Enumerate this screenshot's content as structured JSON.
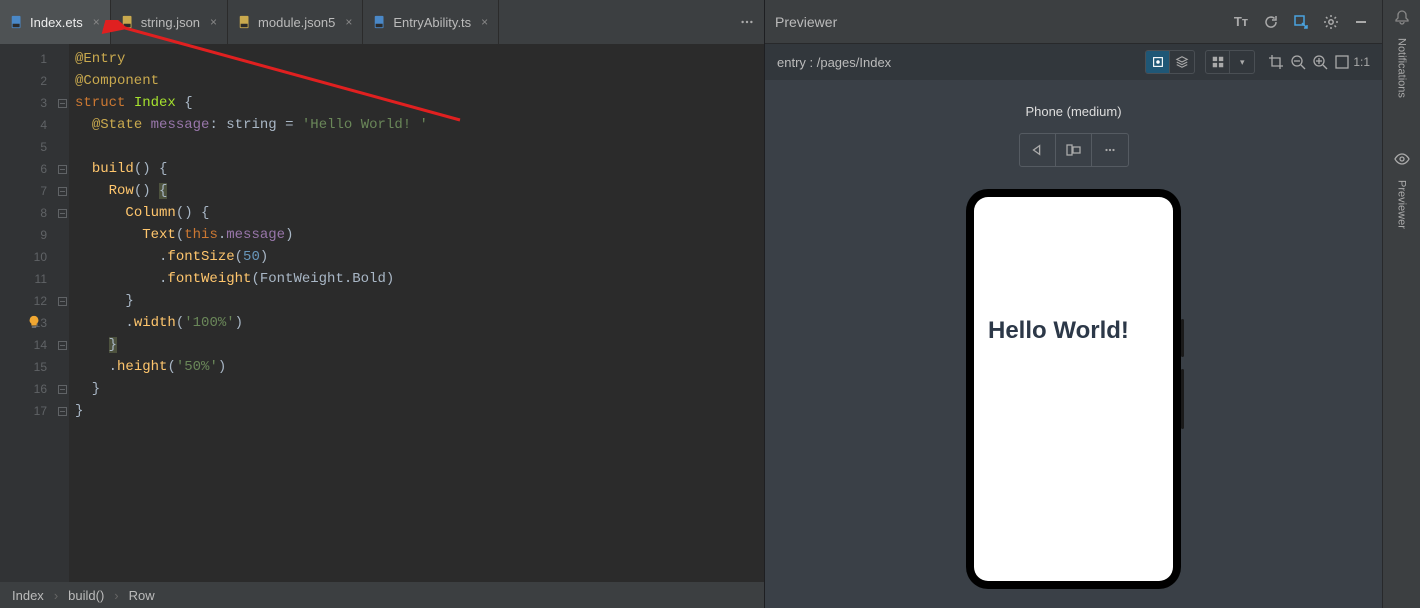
{
  "tabs": [
    {
      "label": "Index.ets",
      "active": true,
      "type": "ets"
    },
    {
      "label": "string.json",
      "active": false,
      "type": "json"
    },
    {
      "label": "module.json5",
      "active": false,
      "type": "json5"
    },
    {
      "label": "EntryAbility.ts",
      "active": false,
      "type": "ts"
    }
  ],
  "line_count": 17,
  "code_lines": [
    [
      {
        "c": "tok-ann",
        "t": "@Entry"
      }
    ],
    [
      {
        "c": "tok-ann",
        "t": "@Component"
      }
    ],
    [
      {
        "c": "tok-kw",
        "t": "struct"
      },
      {
        "c": "",
        "t": " "
      },
      {
        "c": "tok-struct",
        "t": "Index"
      },
      {
        "c": "",
        "t": " {"
      }
    ],
    [
      {
        "c": "",
        "t": "  "
      },
      {
        "c": "tok-ann",
        "t": "@State"
      },
      {
        "c": "",
        "t": " "
      },
      {
        "c": "tok-prop",
        "t": "message"
      },
      {
        "c": "",
        "t": ": "
      },
      {
        "c": "tok-type",
        "t": "string"
      },
      {
        "c": "",
        "t": " = "
      },
      {
        "c": "tok-string",
        "t": "'Hello World! '"
      }
    ],
    [
      {
        "c": "",
        "t": ""
      }
    ],
    [
      {
        "c": "",
        "t": "  "
      },
      {
        "c": "tok-method",
        "t": "build"
      },
      {
        "c": "",
        "t": "() {"
      }
    ],
    [
      {
        "c": "",
        "t": "    "
      },
      {
        "c": "tok-method",
        "t": "Row"
      },
      {
        "c": "",
        "t": "() "
      },
      {
        "c": "tok-brace-h",
        "t": "{"
      }
    ],
    [
      {
        "c": "",
        "t": "      "
      },
      {
        "c": "tok-method",
        "t": "Column"
      },
      {
        "c": "",
        "t": "() {"
      }
    ],
    [
      {
        "c": "",
        "t": "        "
      },
      {
        "c": "tok-method",
        "t": "Text"
      },
      {
        "c": "",
        "t": "("
      },
      {
        "c": "tok-this",
        "t": "this"
      },
      {
        "c": "",
        "t": "."
      },
      {
        "c": "tok-prop",
        "t": "message"
      },
      {
        "c": "",
        "t": ")"
      }
    ],
    [
      {
        "c": "",
        "t": "          ."
      },
      {
        "c": "tok-method",
        "t": "fontSize"
      },
      {
        "c": "",
        "t": "("
      },
      {
        "c": "tok-num",
        "t": "50"
      },
      {
        "c": "",
        "t": ")"
      }
    ],
    [
      {
        "c": "",
        "t": "          ."
      },
      {
        "c": "tok-method",
        "t": "fontWeight"
      },
      {
        "c": "",
        "t": "(FontWeight.Bold)"
      }
    ],
    [
      {
        "c": "",
        "t": "      }"
      }
    ],
    [
      {
        "c": "",
        "t": "      ."
      },
      {
        "c": "tok-method",
        "t": "width"
      },
      {
        "c": "",
        "t": "("
      },
      {
        "c": "tok-string",
        "t": "'100%'"
      },
      {
        "c": "",
        "t": ")"
      }
    ],
    [
      {
        "c": "",
        "t": "    "
      },
      {
        "c": "tok-brace-h",
        "t": "}"
      }
    ],
    [
      {
        "c": "",
        "t": "    ."
      },
      {
        "c": "tok-method",
        "t": "height"
      },
      {
        "c": "",
        "t": "("
      },
      {
        "c": "tok-string",
        "t": "'50%'"
      },
      {
        "c": "",
        "t": ")"
      }
    ],
    [
      {
        "c": "",
        "t": "  }"
      }
    ],
    [
      {
        "c": "",
        "t": "}"
      }
    ]
  ],
  "fold_marks": {
    "3": "-",
    "6": "-",
    "7": "-",
    "8": "-",
    "12": "-",
    "14": "-",
    "16": "-",
    "17": "-"
  },
  "bulb_line": 13,
  "breadcrumb": [
    "Index",
    "build()",
    "Row"
  ],
  "previewer": {
    "title": "Previewer",
    "path": "entry : /pages/Index",
    "device_label": "Phone (medium)",
    "rendered_text": "Hello World!",
    "zoom_label": "1:1"
  },
  "right_sidebar": {
    "notifications": "Notifications",
    "previewer": "Previewer"
  }
}
